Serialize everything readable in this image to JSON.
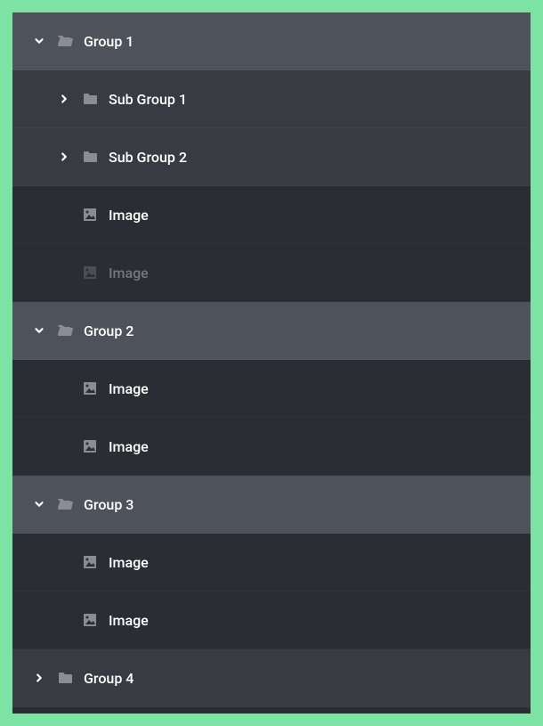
{
  "tree": {
    "group1": {
      "label": "Group 1",
      "subgroup1": {
        "label": "Sub Group 1"
      },
      "subgroup2": {
        "label": "Sub Group 2"
      },
      "image1": {
        "label": "Image"
      },
      "image2": {
        "label": "Image"
      }
    },
    "group2": {
      "label": "Group 2",
      "image1": {
        "label": "Image"
      },
      "image2": {
        "label": "Image"
      }
    },
    "group3": {
      "label": "Group 3",
      "image1": {
        "label": "Image"
      },
      "image2": {
        "label": "Image"
      }
    },
    "group4": {
      "label": "Group 4"
    }
  },
  "colors": {
    "background": "#7de3a5",
    "expanded_row": "#4e525a",
    "collapsed_row": "#383b42",
    "item_row": "#2a2d33"
  }
}
